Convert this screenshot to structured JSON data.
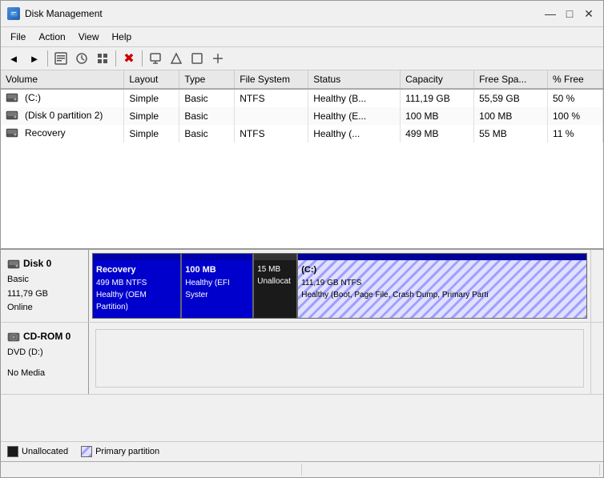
{
  "window": {
    "title": "Disk Management",
    "icon": "disk-icon"
  },
  "title_buttons": {
    "minimize": "—",
    "maximize": "□",
    "close": "✕"
  },
  "menu": {
    "items": [
      "File",
      "Action",
      "View",
      "Help"
    ]
  },
  "toolbar": {
    "buttons": [
      "◄",
      "►",
      "☰",
      "✎",
      "▦",
      "🔃",
      "✖",
      "📋",
      "⬛",
      "▷",
      "⬜"
    ]
  },
  "table": {
    "columns": [
      "Volume",
      "Layout",
      "Type",
      "File System",
      "Status",
      "Capacity",
      "Free Spa...",
      "% Free"
    ],
    "rows": [
      {
        "volume": "(C:)",
        "layout": "Simple",
        "type": "Basic",
        "file_system": "NTFS",
        "status": "Healthy (B...",
        "capacity": "111,19 GB",
        "free_space": "55,59 GB",
        "percent_free": "50 %",
        "icon": "hdd-icon"
      },
      {
        "volume": "(Disk 0 partition 2)",
        "layout": "Simple",
        "type": "Basic",
        "file_system": "",
        "status": "Healthy (E...",
        "capacity": "100 MB",
        "free_space": "100 MB",
        "percent_free": "100 %",
        "icon": "hdd-icon"
      },
      {
        "volume": "Recovery",
        "layout": "Simple",
        "type": "Basic",
        "file_system": "NTFS",
        "status": "Healthy (...",
        "capacity": "499 MB",
        "free_space": "55 MB",
        "percent_free": "11 %",
        "icon": "hdd-icon"
      }
    ]
  },
  "disks": [
    {
      "label": "Disk 0",
      "type": "Basic",
      "size": "111,79 GB",
      "status": "Online",
      "partitions": [
        {
          "name": "Recovery",
          "size": "499 MB NTFS",
          "status": "Healthy (OEM Partition)",
          "type": "recovery",
          "width": "18%"
        },
        {
          "name": "100 MB",
          "size": "",
          "status": "Healthy (EFI Syster",
          "type": "efi",
          "width": "16%"
        },
        {
          "name": "15 MB",
          "size": "",
          "status": "Unallocat",
          "type": "unallocated",
          "width": "8%"
        },
        {
          "name": "(C:)",
          "size": "111,19 GB NTFS",
          "status": "Healthy (Boot, Page File, Crash Dump, Primary Parti",
          "type": "primary",
          "width": "58%"
        }
      ]
    },
    {
      "label": "CD-ROM 0",
      "type": "DVD (D:)",
      "size": "",
      "status": "No Media",
      "partitions": []
    }
  ],
  "legend": {
    "items": [
      {
        "type": "unalloc",
        "label": "Unallocated"
      },
      {
        "type": "primary-p",
        "label": "Primary partition"
      }
    ]
  }
}
